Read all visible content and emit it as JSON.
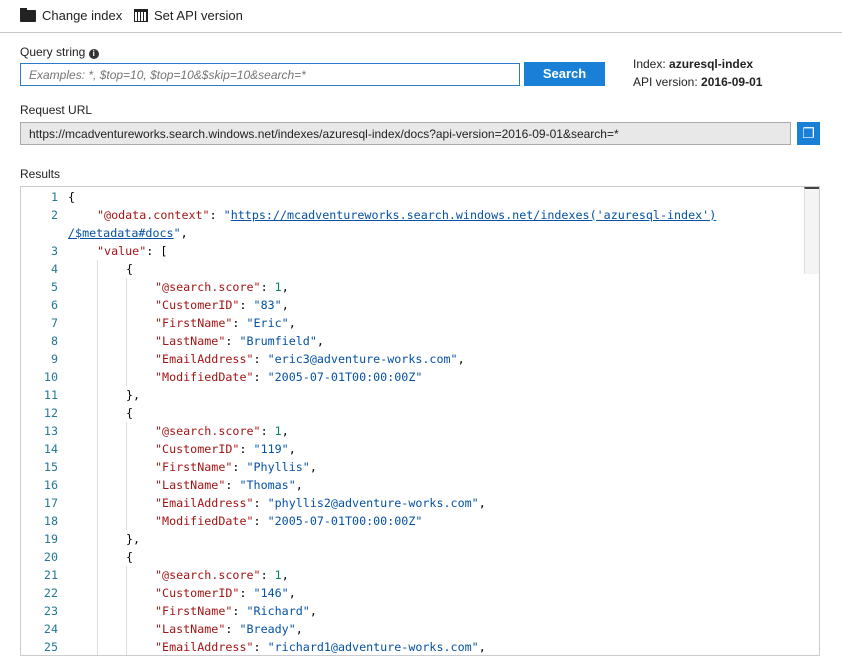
{
  "toolbar": {
    "change_index": "Change index",
    "set_api": "Set API version"
  },
  "query": {
    "label": "Query string",
    "placeholder": "Examples: *, $top=10, $top=10&$skip=10&search=*",
    "search_button": "Search"
  },
  "info": {
    "index_label": "Index:",
    "index_value": "azuresql-index",
    "api_label": "API version:",
    "api_value": "2016-09-01"
  },
  "request": {
    "label": "Request URL",
    "url": "https://mcadventureworks.search.windows.net/indexes/azuresql-index/docs?api-version=2016-09-01&search=*"
  },
  "results": {
    "label": "Results",
    "lines": [
      {
        "n": "1",
        "i": 0,
        "t": [
          [
            "p",
            "{"
          ]
        ]
      },
      {
        "n": "2",
        "i": 1,
        "t": [
          [
            "k",
            "\"@odata.context\""
          ],
          [
            "p",
            ": "
          ],
          [
            "s",
            "\""
          ],
          [
            "u",
            "https://mcadventureworks.search.windows.net/indexes('azuresql-index')"
          ]
        ]
      },
      {
        "n": "",
        "i": 0,
        "t": [
          [
            "u",
            "/$metadata#docs"
          ],
          [
            "s",
            "\""
          ],
          [
            "p",
            ","
          ]
        ]
      },
      {
        "n": "3",
        "i": 1,
        "t": [
          [
            "k",
            "\"value\""
          ],
          [
            "p",
            ": ["
          ]
        ]
      },
      {
        "n": "4",
        "i": 2,
        "t": [
          [
            "p",
            "{"
          ]
        ]
      },
      {
        "n": "5",
        "i": 3,
        "t": [
          [
            "k",
            "\"@search.score\""
          ],
          [
            "p",
            ": "
          ],
          [
            "n",
            "1"
          ],
          [
            "p",
            ","
          ]
        ]
      },
      {
        "n": "6",
        "i": 3,
        "t": [
          [
            "k",
            "\"CustomerID\""
          ],
          [
            "p",
            ": "
          ],
          [
            "s",
            "\"83\""
          ],
          [
            "p",
            ","
          ]
        ]
      },
      {
        "n": "7",
        "i": 3,
        "t": [
          [
            "k",
            "\"FirstName\""
          ],
          [
            "p",
            ": "
          ],
          [
            "s",
            "\"Eric\""
          ],
          [
            "p",
            ","
          ]
        ]
      },
      {
        "n": "8",
        "i": 3,
        "t": [
          [
            "k",
            "\"LastName\""
          ],
          [
            "p",
            ": "
          ],
          [
            "s",
            "\"Brumfield\""
          ],
          [
            "p",
            ","
          ]
        ]
      },
      {
        "n": "9",
        "i": 3,
        "t": [
          [
            "k",
            "\"EmailAddress\""
          ],
          [
            "p",
            ": "
          ],
          [
            "s",
            "\"eric3@adventure-works.com\""
          ],
          [
            "p",
            ","
          ]
        ]
      },
      {
        "n": "10",
        "i": 3,
        "t": [
          [
            "k",
            "\"ModifiedDate\""
          ],
          [
            "p",
            ": "
          ],
          [
            "s",
            "\"2005-07-01T00:00:00Z\""
          ]
        ]
      },
      {
        "n": "11",
        "i": 2,
        "t": [
          [
            "p",
            "},"
          ]
        ]
      },
      {
        "n": "12",
        "i": 2,
        "t": [
          [
            "p",
            "{"
          ]
        ]
      },
      {
        "n": "13",
        "i": 3,
        "t": [
          [
            "k",
            "\"@search.score\""
          ],
          [
            "p",
            ": "
          ],
          [
            "n",
            "1"
          ],
          [
            "p",
            ","
          ]
        ]
      },
      {
        "n": "14",
        "i": 3,
        "t": [
          [
            "k",
            "\"CustomerID\""
          ],
          [
            "p",
            ": "
          ],
          [
            "s",
            "\"119\""
          ],
          [
            "p",
            ","
          ]
        ]
      },
      {
        "n": "15",
        "i": 3,
        "t": [
          [
            "k",
            "\"FirstName\""
          ],
          [
            "p",
            ": "
          ],
          [
            "s",
            "\"Phyllis\""
          ],
          [
            "p",
            ","
          ]
        ]
      },
      {
        "n": "16",
        "i": 3,
        "t": [
          [
            "k",
            "\"LastName\""
          ],
          [
            "p",
            ": "
          ],
          [
            "s",
            "\"Thomas\""
          ],
          [
            "p",
            ","
          ]
        ]
      },
      {
        "n": "17",
        "i": 3,
        "t": [
          [
            "k",
            "\"EmailAddress\""
          ],
          [
            "p",
            ": "
          ],
          [
            "s",
            "\"phyllis2@adventure-works.com\""
          ],
          [
            "p",
            ","
          ]
        ]
      },
      {
        "n": "18",
        "i": 3,
        "t": [
          [
            "k",
            "\"ModifiedDate\""
          ],
          [
            "p",
            ": "
          ],
          [
            "s",
            "\"2005-07-01T00:00:00Z\""
          ]
        ]
      },
      {
        "n": "19",
        "i": 2,
        "t": [
          [
            "p",
            "},"
          ]
        ]
      },
      {
        "n": "20",
        "i": 2,
        "t": [
          [
            "p",
            "{"
          ]
        ]
      },
      {
        "n": "21",
        "i": 3,
        "t": [
          [
            "k",
            "\"@search.score\""
          ],
          [
            "p",
            ": "
          ],
          [
            "n",
            "1"
          ],
          [
            "p",
            ","
          ]
        ]
      },
      {
        "n": "22",
        "i": 3,
        "t": [
          [
            "k",
            "\"CustomerID\""
          ],
          [
            "p",
            ": "
          ],
          [
            "s",
            "\"146\""
          ],
          [
            "p",
            ","
          ]
        ]
      },
      {
        "n": "23",
        "i": 3,
        "t": [
          [
            "k",
            "\"FirstName\""
          ],
          [
            "p",
            ": "
          ],
          [
            "s",
            "\"Richard\""
          ],
          [
            "p",
            ","
          ]
        ]
      },
      {
        "n": "24",
        "i": 3,
        "t": [
          [
            "k",
            "\"LastName\""
          ],
          [
            "p",
            ": "
          ],
          [
            "s",
            "\"Bready\""
          ],
          [
            "p",
            ","
          ]
        ]
      },
      {
        "n": "25",
        "i": 3,
        "t": [
          [
            "k",
            "\"EmailAddress\""
          ],
          [
            "p",
            ": "
          ],
          [
            "s",
            "\"richard1@adventure-works.com\""
          ],
          [
            "p",
            ","
          ]
        ]
      }
    ]
  }
}
